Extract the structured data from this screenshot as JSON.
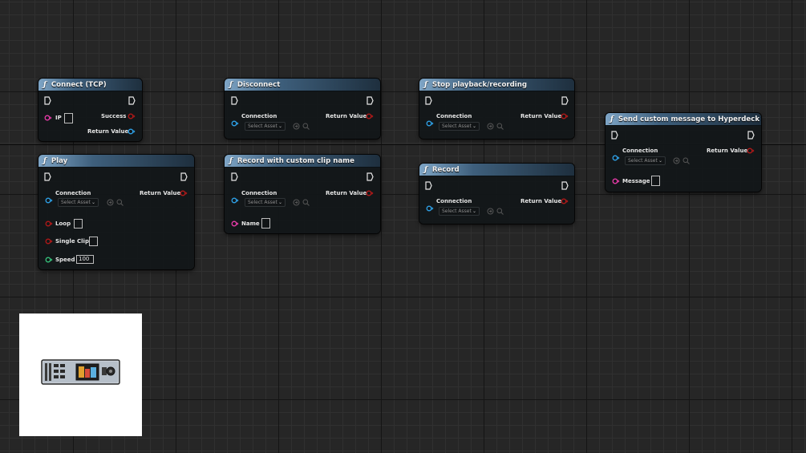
{
  "nodes": {
    "connect_tcp": {
      "title": "Connect (TCP)",
      "ip_label": "IP",
      "success_label": "Success",
      "return_label": "Return Value"
    },
    "disconnect": {
      "title": "Disconnect",
      "connection_label": "Connection",
      "asset_placeholder": "Select Asset",
      "return_label": "Return Value"
    },
    "stop_playback": {
      "title": "Stop playback/recording",
      "connection_label": "Connection",
      "asset_placeholder": "Select Asset",
      "return_label": "Return Value"
    },
    "send_custom": {
      "title": "Send custom message to Hyperdeck",
      "connection_label": "Connection",
      "asset_placeholder": "Select Asset",
      "return_label": "Return Value",
      "message_label": "Message"
    },
    "play": {
      "title": "Play",
      "connection_label": "Connection",
      "asset_placeholder": "Select Asset",
      "return_label": "Return Value",
      "loop_label": "Loop",
      "single_clip_label": "Single Clip",
      "speed_label": "Speed",
      "speed_value": "100"
    },
    "record_custom": {
      "title": "Record with custom clip name",
      "connection_label": "Connection",
      "asset_placeholder": "Select Asset",
      "return_label": "Return Value",
      "name_label": "Name"
    },
    "record": {
      "title": "Record",
      "connection_label": "Connection",
      "asset_placeholder": "Select Asset",
      "return_label": "Return Value"
    }
  },
  "colors": {
    "header_accent": "#7ea5c6",
    "pin_object": "#2ea0e6",
    "pin_string": "#e63ba8",
    "pin_bool": "#b01818",
    "pin_float": "#35c17a",
    "pin_exec": "#e6e6e6"
  },
  "icons": {
    "function": "function-icon",
    "exec": "exec-pin-icon",
    "browse": "browse-icon",
    "search": "search-icon",
    "thumbnail": "hyperdeck-device-thumbnail"
  }
}
